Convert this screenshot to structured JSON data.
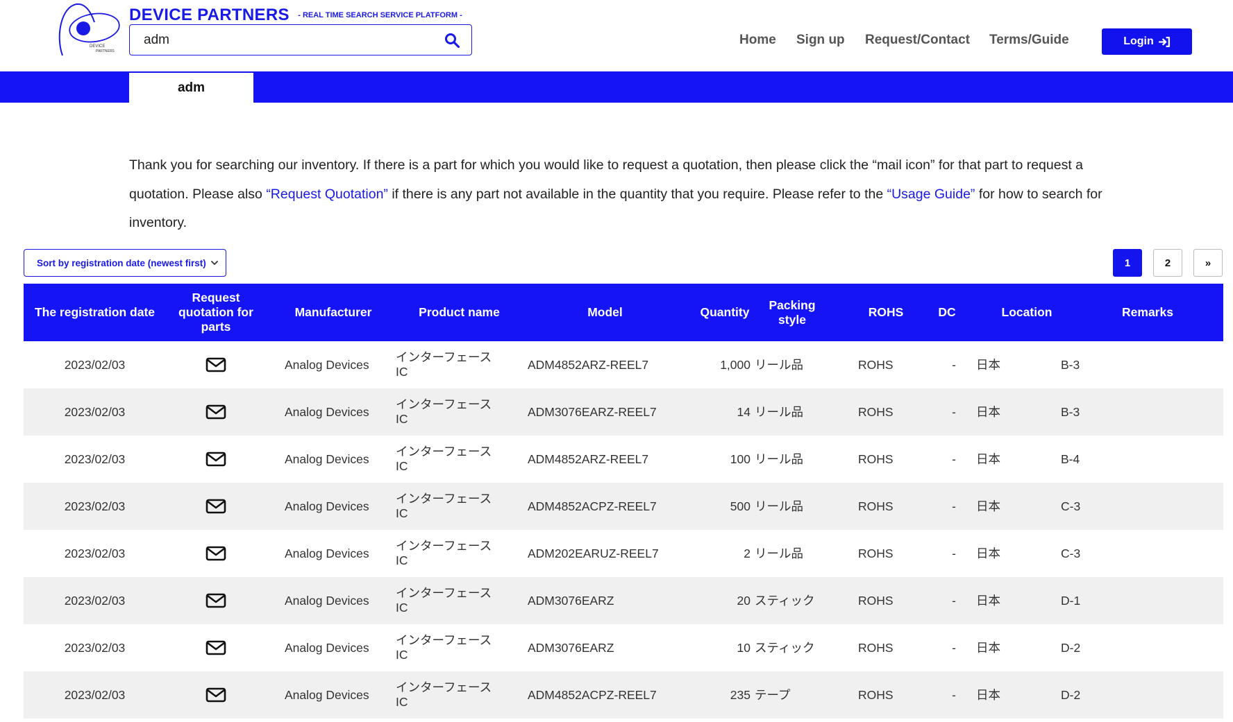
{
  "brand": {
    "name": "DEVICE PARTNERS",
    "tagline": "- REAL TIME SEARCH SERVICE PLATFORM -",
    "logo_text_line1": "DEVICE",
    "logo_text_line2": "PARTNERS"
  },
  "search": {
    "value": "adm",
    "placeholder": ""
  },
  "nav": {
    "home": "Home",
    "signup": "Sign up",
    "request": "Request/Contact",
    "terms": "Terms/Guide",
    "login": "Login"
  },
  "band": {
    "active_tab": "adm"
  },
  "intro": {
    "p1": "Thank you for searching our inventory. If there is a part for which you would like to request a quotation, then please click the “mail icon” for that part to request a quotation. Please also ",
    "link1": "“Request Quotation”",
    "p2": " if there is any part not available in the quantity that you require. Please refer to the ",
    "link2": "“Usage Guide”",
    "p3": " for how to search for inventory."
  },
  "sort": {
    "selected": "Sort by registration date (newest first)"
  },
  "pagination": {
    "pages": [
      "1",
      "2"
    ],
    "current": "1",
    "next": "»"
  },
  "table": {
    "headers": {
      "date": "The registration date",
      "request": "Request quotation for parts",
      "manufacturer": "Manufacturer",
      "product": "Product name",
      "model": "Model",
      "quantity": "Quantity",
      "packing": "Packing style",
      "rohs": "ROHS",
      "dc": "DC",
      "location": "Location",
      "remarks": "Remarks"
    },
    "rows": [
      {
        "date": "2023/02/03",
        "manufacturer": "Analog Devices",
        "product": "インターフェース IC",
        "model": "ADM4852ARZ-REEL7",
        "quantity": "1,000",
        "packing": "リール品",
        "rohs": "ROHS",
        "dc": "-",
        "location": "日本",
        "remarks": "B-3"
      },
      {
        "date": "2023/02/03",
        "manufacturer": "Analog Devices",
        "product": "インターフェース IC",
        "model": "ADM3076EARZ-REEL7",
        "quantity": "14",
        "packing": "リール品",
        "rohs": "ROHS",
        "dc": "-",
        "location": "日本",
        "remarks": "B-3"
      },
      {
        "date": "2023/02/03",
        "manufacturer": "Analog Devices",
        "product": "インターフェース IC",
        "model": "ADM4852ARZ-REEL7",
        "quantity": "100",
        "packing": "リール品",
        "rohs": "ROHS",
        "dc": "-",
        "location": "日本",
        "remarks": "B-4"
      },
      {
        "date": "2023/02/03",
        "manufacturer": "Analog Devices",
        "product": "インターフェース IC",
        "model": "ADM4852ACPZ-REEL7",
        "quantity": "500",
        "packing": "リール品",
        "rohs": "ROHS",
        "dc": "-",
        "location": "日本",
        "remarks": "C-3"
      },
      {
        "date": "2023/02/03",
        "manufacturer": "Analog Devices",
        "product": "インターフェース IC",
        "model": "ADM202EARUZ-REEL7",
        "quantity": "2",
        "packing": "リール品",
        "rohs": "ROHS",
        "dc": "-",
        "location": "日本",
        "remarks": "C-3"
      },
      {
        "date": "2023/02/03",
        "manufacturer": "Analog Devices",
        "product": "インターフェース IC",
        "model": "ADM3076EARZ",
        "quantity": "20",
        "packing": "スティック",
        "rohs": "ROHS",
        "dc": "-",
        "location": "日本",
        "remarks": "D-1"
      },
      {
        "date": "2023/02/03",
        "manufacturer": "Analog Devices",
        "product": "インターフェース IC",
        "model": "ADM3076EARZ",
        "quantity": "10",
        "packing": "スティック",
        "rohs": "ROHS",
        "dc": "-",
        "location": "日本",
        "remarks": "D-2"
      },
      {
        "date": "2023/02/03",
        "manufacturer": "Analog Devices",
        "product": "インターフェース IC",
        "model": "ADM4852ACPZ-REEL7",
        "quantity": "235",
        "packing": "テープ",
        "rohs": "ROHS",
        "dc": "-",
        "location": "日本",
        "remarks": "D-2"
      }
    ]
  },
  "icons": {
    "search": "search-icon",
    "login": "sign-in-icon",
    "mail": "envelope-icon",
    "sort": "chevron-down-icon"
  },
  "colors": {
    "brand_blue": "#1414f5",
    "link_blue": "#1a1ae6",
    "row_alt": "#f0f0f0"
  }
}
